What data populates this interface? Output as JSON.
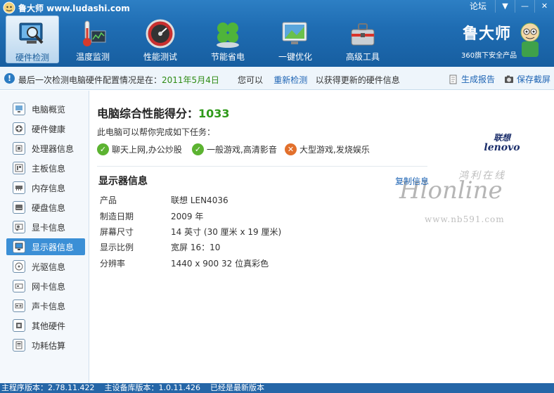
{
  "app": {
    "title": "鲁大师 www.ludashi.com",
    "forum": "论坛",
    "win_menu": "▼",
    "win_min": "—",
    "win_close": "✕"
  },
  "nav_tabs": [
    {
      "label": "硬件检测",
      "icon": "monitor-magnifier-icon",
      "active": true
    },
    {
      "label": "温度监测",
      "icon": "thermometer-icon"
    },
    {
      "label": "性能测试",
      "icon": "speedometer-icon"
    },
    {
      "label": "节能省电",
      "icon": "clover-icon"
    },
    {
      "label": "一键优化",
      "icon": "optimize-screen-icon"
    },
    {
      "label": "高级工具",
      "icon": "toolbox-icon"
    }
  ],
  "brand": {
    "name": "鲁大师",
    "tagline": "360旗下安全产品"
  },
  "infobar": {
    "prefix": "最后一次检测电脑硬件配置情况是在：",
    "date": "2011年5月4日",
    "mid_prefix": "您可以",
    "redetect": "重新检测",
    "mid_suffix": "以获得更新的硬件信息",
    "report": "生成报告",
    "save_screenshot": "保存截屏"
  },
  "sidebar": {
    "items": [
      {
        "label": "电脑概览"
      },
      {
        "label": "硬件健康"
      },
      {
        "label": "处理器信息"
      },
      {
        "label": "主板信息"
      },
      {
        "label": "内存信息"
      },
      {
        "label": "硬盘信息"
      },
      {
        "label": "显卡信息"
      },
      {
        "label": "显示器信息",
        "active": true
      },
      {
        "label": "光驱信息"
      },
      {
        "label": "网卡信息"
      },
      {
        "label": "声卡信息"
      },
      {
        "label": "其他硬件"
      },
      {
        "label": "功耗估算"
      }
    ]
  },
  "main": {
    "score_label": "电脑综合性能得分：",
    "score_value": "1033",
    "tasks_caption": "此电脑可以帮你完成如下任务：",
    "tasks": [
      {
        "label": "聊天上网,办公炒股",
        "ok": true
      },
      {
        "label": "一般游戏,高清影音",
        "ok": true
      },
      {
        "label": "大型游戏,发烧娱乐",
        "ok": false
      }
    ],
    "vendor_logo": {
      "cn": "联想",
      "en": "lenovo"
    },
    "section_title": "显示器信息",
    "copy_info": "复制信息",
    "rows": [
      {
        "k": "产品",
        "v": "联想 LEN4036"
      },
      {
        "k": "制造日期",
        "v": "2009 年"
      },
      {
        "k": "屏幕尺寸",
        "v": "14 英寸 (30 厘米 x 19 厘米)"
      },
      {
        "k": "显示比例",
        "v": "宽屏 16：10"
      },
      {
        "k": "分辨率",
        "v": "1440 x 900 32 位真彩色"
      }
    ]
  },
  "watermark": {
    "cn": "鸿利在线",
    "big": "Hlonline",
    "url": "www.nb591.com"
  },
  "statusbar": {
    "main_version": "主程序版本：2.78.11.422",
    "db_version": "主设备库版本：1.0.11.426",
    "status": "已经是最新版本"
  },
  "colors": {
    "toolbar_blue": "#1f6db3",
    "score_green": "#2f9a1a",
    "link_blue": "#1e64b4",
    "active_side": "#3b8fd6"
  }
}
